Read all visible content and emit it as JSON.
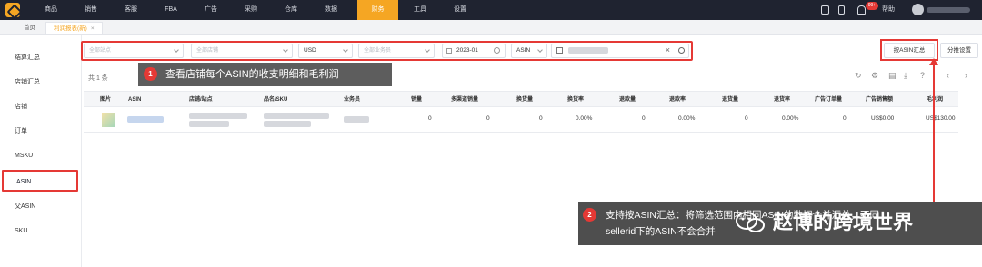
{
  "topbar": {
    "nav": [
      "商品",
      "销售",
      "客服",
      "FBA",
      "广告",
      "采购",
      "仓库",
      "数据",
      "财务",
      "工具",
      "设置"
    ],
    "active_nav": "财务",
    "badge": "99+",
    "help": "帮助"
  },
  "tabs": [
    {
      "label": "首页"
    },
    {
      "label": "利润报表(新)",
      "close": "×"
    }
  ],
  "sidebar": {
    "items": [
      {
        "label": "结算汇总"
      },
      {
        "label": "店铺汇总"
      },
      {
        "label": "店铺"
      },
      {
        "label": "订单"
      },
      {
        "label": "MSKU"
      },
      {
        "label": "ASIN"
      },
      {
        "label": "父ASIN"
      },
      {
        "label": "SKU"
      }
    ],
    "selected": "ASIN"
  },
  "filters": {
    "site": "全部站点",
    "store": "全部店铺",
    "currency": "USD",
    "salesperson": "全部业务员",
    "date": "2023-01",
    "dim": "ASIN"
  },
  "buttons": {
    "by_asin": "按ASIN汇总",
    "split": "分推设置"
  },
  "count_label": "共 1 条",
  "table": {
    "headers": [
      "图片",
      "ASIN",
      "店铺/站点",
      "品名/SKU",
      "业务员",
      "销量",
      "多渠道销量",
      "换货量",
      "换货率",
      "退款量",
      "退款率",
      "退货量",
      "退货率",
      "广告订单量",
      "广告销售额",
      "毛利润"
    ],
    "row": {
      "sales": "0",
      "multichannel": "0",
      "exchange_qty": "0",
      "exchange_rate": "0.00%",
      "refund_qty": "0",
      "refund_rate": "0.00%",
      "return_qty": "0",
      "return_rate": "0.00%",
      "ad_orders": "0",
      "ad_sales": "US$0.00",
      "gross_profit": "US$130.00"
    }
  },
  "annotations": {
    "one_num": "1",
    "one_text": "查看店铺每个ASIN的收支明细和毛利润",
    "two_num": "2",
    "two_line1": "支持按ASIN汇总：将筛选范围内相同ASIN的数据合并汇总，不同",
    "two_line2": "sellerid下的ASIN不会合并",
    "watermark": "赵博的跨境世界"
  },
  "colors": {
    "topbar": "#1f2330",
    "accent": "#f5a623",
    "highlight": "#e53935"
  }
}
